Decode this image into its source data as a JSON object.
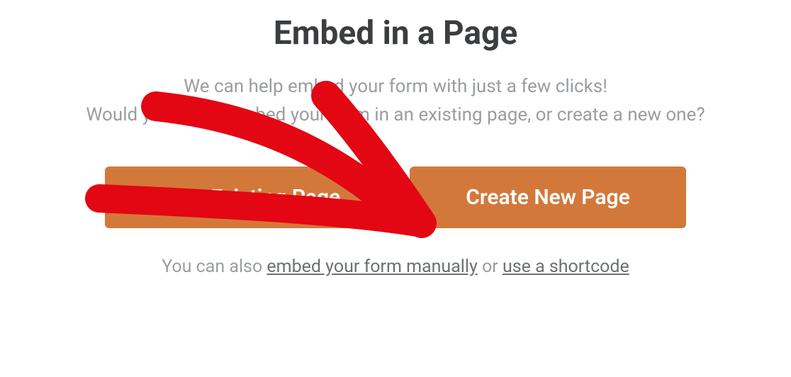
{
  "modal": {
    "title": "Embed in a Page",
    "subtitle_line1": "We can help embed your form with just a few clicks!",
    "subtitle_line2": "Would you like to embed your form in an existing page, or create a new one?",
    "buttons": {
      "select_existing": "Select Existing Page",
      "create_new": "Create New Page"
    },
    "footer": {
      "prefix": "You can also ",
      "link1": "embed your form manually",
      "middle": " or ",
      "link2": "use a shortcode"
    }
  },
  "annotation": {
    "type": "arrow",
    "color": "#e30613",
    "points_to": "create-new-page-button"
  }
}
